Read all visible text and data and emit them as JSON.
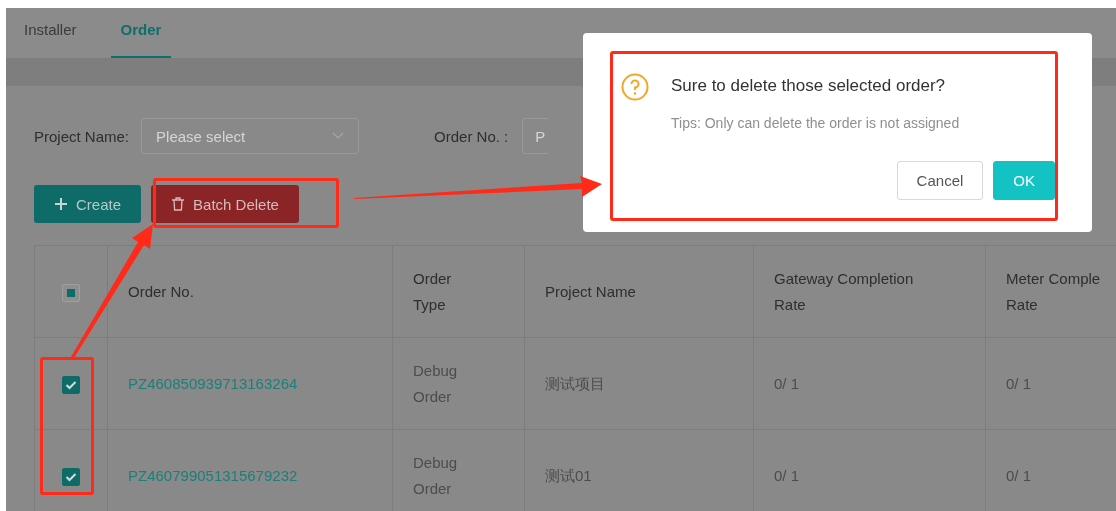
{
  "tabs": [
    {
      "label": "Installer",
      "selected": false
    },
    {
      "label": "Order",
      "selected": true
    }
  ],
  "filters": {
    "project_name": {
      "label": "Project Name:",
      "placeholder": "Please select"
    },
    "order_no": {
      "label": "Order No. :",
      "placeholder": "P"
    }
  },
  "actions": [
    {
      "kind": "create",
      "label": "Create"
    },
    {
      "kind": "delete",
      "label": "Batch Delete"
    }
  ],
  "table": {
    "select_all": {
      "indeterminate": true
    },
    "columns": [
      "Order No.",
      "Order Type",
      "Project Name",
      "Gateway Completion Rate",
      "Meter Comple Rate"
    ],
    "rows": [
      {
        "checked": true,
        "order_no": "PZ460850939713163264",
        "order_type": "Debug Order",
        "project_name": "测试项目",
        "gateway_rate": "0/ 1",
        "meter_rate": "0/ 1"
      },
      {
        "checked": true,
        "order_no": "PZ460799051315679232",
        "order_type": "Debug Order",
        "project_name": "测试01",
        "gateway_rate": "0/ 1",
        "meter_rate": "0/ 1"
      }
    ]
  },
  "dialog": {
    "title": "Sure to delete those selected order?",
    "tip": "Tips: Only can delete the order is not assigned",
    "buttons": [
      {
        "kind": "secondary",
        "label": "Cancel"
      },
      {
        "kind": "primary",
        "label": "OK"
      }
    ]
  }
}
